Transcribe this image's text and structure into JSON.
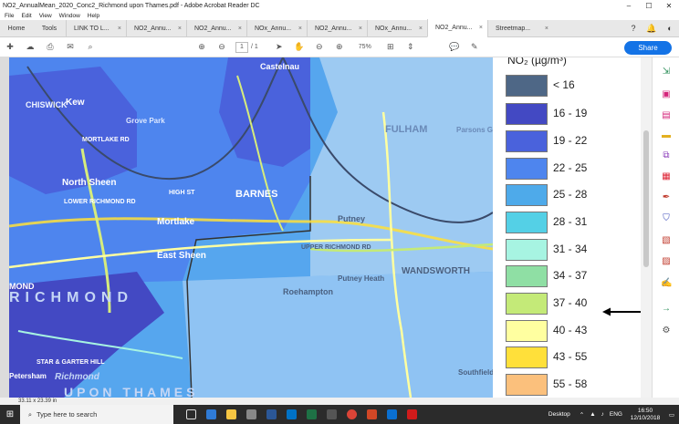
{
  "window": {
    "title": "NO2_AnnualMean_2020_Conc2_Richmond upon Thames.pdf - Adobe Acrobat Reader DC",
    "controls": [
      "–",
      "☐",
      "✕"
    ]
  },
  "menu": [
    "File",
    "Edit",
    "View",
    "Window",
    "Help"
  ],
  "nav": {
    "home": "Home",
    "tools": "Tools"
  },
  "tabs": [
    {
      "label": "LINK TO L...",
      "active": false
    },
    {
      "label": "NO2_Annu...",
      "active": false
    },
    {
      "label": "NO2_Annu...",
      "active": false
    },
    {
      "label": "NOx_Annu...",
      "active": false
    },
    {
      "label": "NO2_Annu...",
      "active": false
    },
    {
      "label": "NOx_Annu...",
      "active": false
    },
    {
      "label": "NO2_Annu...",
      "active": true
    },
    {
      "label": "Streetmap...",
      "active": false
    }
  ],
  "toolbar": {
    "page_current": "1",
    "page_total": "/ 1",
    "zoom": "75%",
    "share_label": "Share"
  },
  "map": {
    "places": [
      "CHISWICK",
      "Castelnau",
      "Kew",
      "Grove Park",
      "North Sheen",
      "BARNES",
      "Mortlake",
      "East Sheen",
      "Putney",
      "FULHAM",
      "Parsons Green",
      "Roehampton",
      "Putney Heath",
      "WANDSWORTH",
      "RICHMOND",
      "Richmond",
      "STAR & GARTER HILL",
      "Southfield",
      "LOWER RICHMOND RD",
      "UPPER RICHMOND RD",
      "MORTLAKE RD",
      "HIGH ST",
      "UPON THAMES",
      "Petersham",
      "MOND"
    ]
  },
  "legend": {
    "title": "NO₂ (µg/m³)",
    "items": [
      {
        "label": "< 16",
        "color": "#4e6786"
      },
      {
        "label": "16 - 19",
        "color": "#4349c3"
      },
      {
        "label": "19 - 22",
        "color": "#4a62dc"
      },
      {
        "label": "22 - 25",
        "color": "#4e85ee"
      },
      {
        "label": "25 - 28",
        "color": "#4eaaea"
      },
      {
        "label": "28 - 31",
        "color": "#54d0e6"
      },
      {
        "label": "31 - 34",
        "color": "#a7f4e2"
      },
      {
        "label": "34 - 37",
        "color": "#8fdfa4"
      },
      {
        "label": "37 - 40",
        "color": "#c4ea78"
      },
      {
        "label": "40 - 43",
        "color": "#ffffa0"
      },
      {
        "label": "43 - 55",
        "color": "#ffe03a"
      },
      {
        "label": "55 - 58",
        "color": "#fbc07c"
      }
    ]
  },
  "status": {
    "page_size": "33.11 x 23.39 in"
  },
  "taskbar": {
    "search_placeholder": "Type here to search",
    "desktop": "Desktop",
    "lang": "ENG",
    "time": "16:50",
    "date": "12/10/2018"
  }
}
